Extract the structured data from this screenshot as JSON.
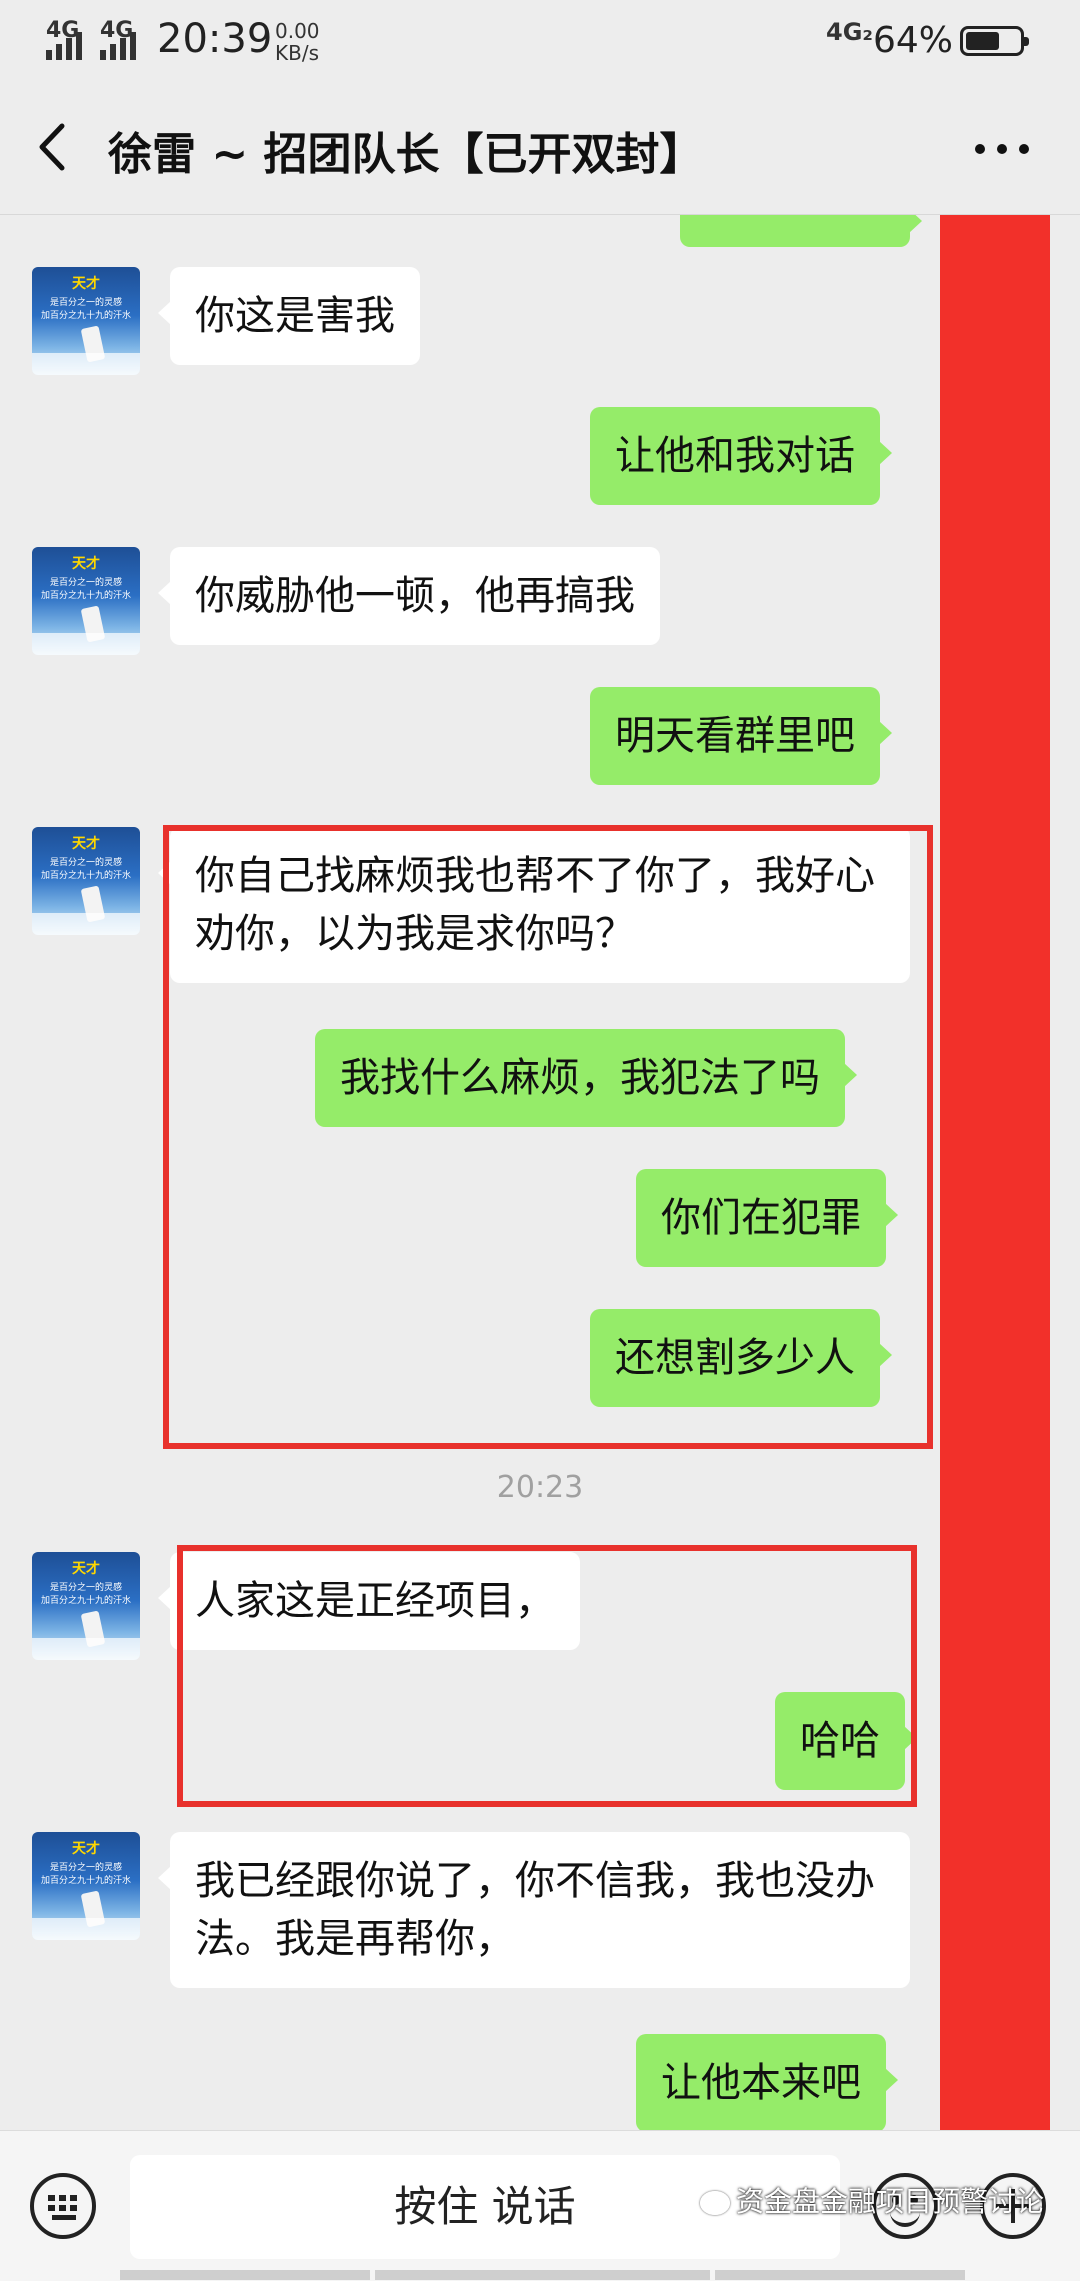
{
  "status_bar": {
    "network_1": "4G",
    "network_2": "4G",
    "time": "20:39",
    "speed_value": "0.00",
    "speed_unit": "KB/s",
    "right_network": "4G₂",
    "battery_percent": "64%",
    "battery_level": 0.64
  },
  "header": {
    "title": "徐雷 ~ 招团队长【已开双封】"
  },
  "avatar": {
    "line1": "天才",
    "line2": "是百分之一的灵感",
    "line3": "加百分之九十九的汗水"
  },
  "messages": [
    {
      "side": "left",
      "text": "你这是害我"
    },
    {
      "side": "right",
      "text": "让他和我对话"
    },
    {
      "side": "left",
      "text": "你威胁他一顿，他再搞我"
    },
    {
      "side": "right",
      "text": "明天看群里吧"
    },
    {
      "side": "left",
      "text": "你自己找麻烦我也帮不了你了，我好心劝你，以为我是求你吗？"
    },
    {
      "side": "right",
      "text": "我找什么麻烦，我犯法了吗"
    },
    {
      "side": "right",
      "text": "你们在犯罪"
    },
    {
      "side": "right",
      "text": "还想割多少人"
    },
    {
      "side": "left",
      "text": "人家这是正经项目，"
    },
    {
      "side": "right",
      "text": "哈哈"
    },
    {
      "side": "left",
      "text": "我已经跟你说了，你不信我，我也没办法。我是再帮你，"
    },
    {
      "side": "right",
      "text": "让他本来吧"
    }
  ],
  "timestamp": "20:23",
  "input_bar": {
    "hold_to_talk": "按住 说话"
  },
  "watermark": "资金盘金融项目预警讨论",
  "colors": {
    "green_bubble": "#95ec69",
    "redaction": "#f2302a",
    "highlight_box": "#e8312c"
  }
}
